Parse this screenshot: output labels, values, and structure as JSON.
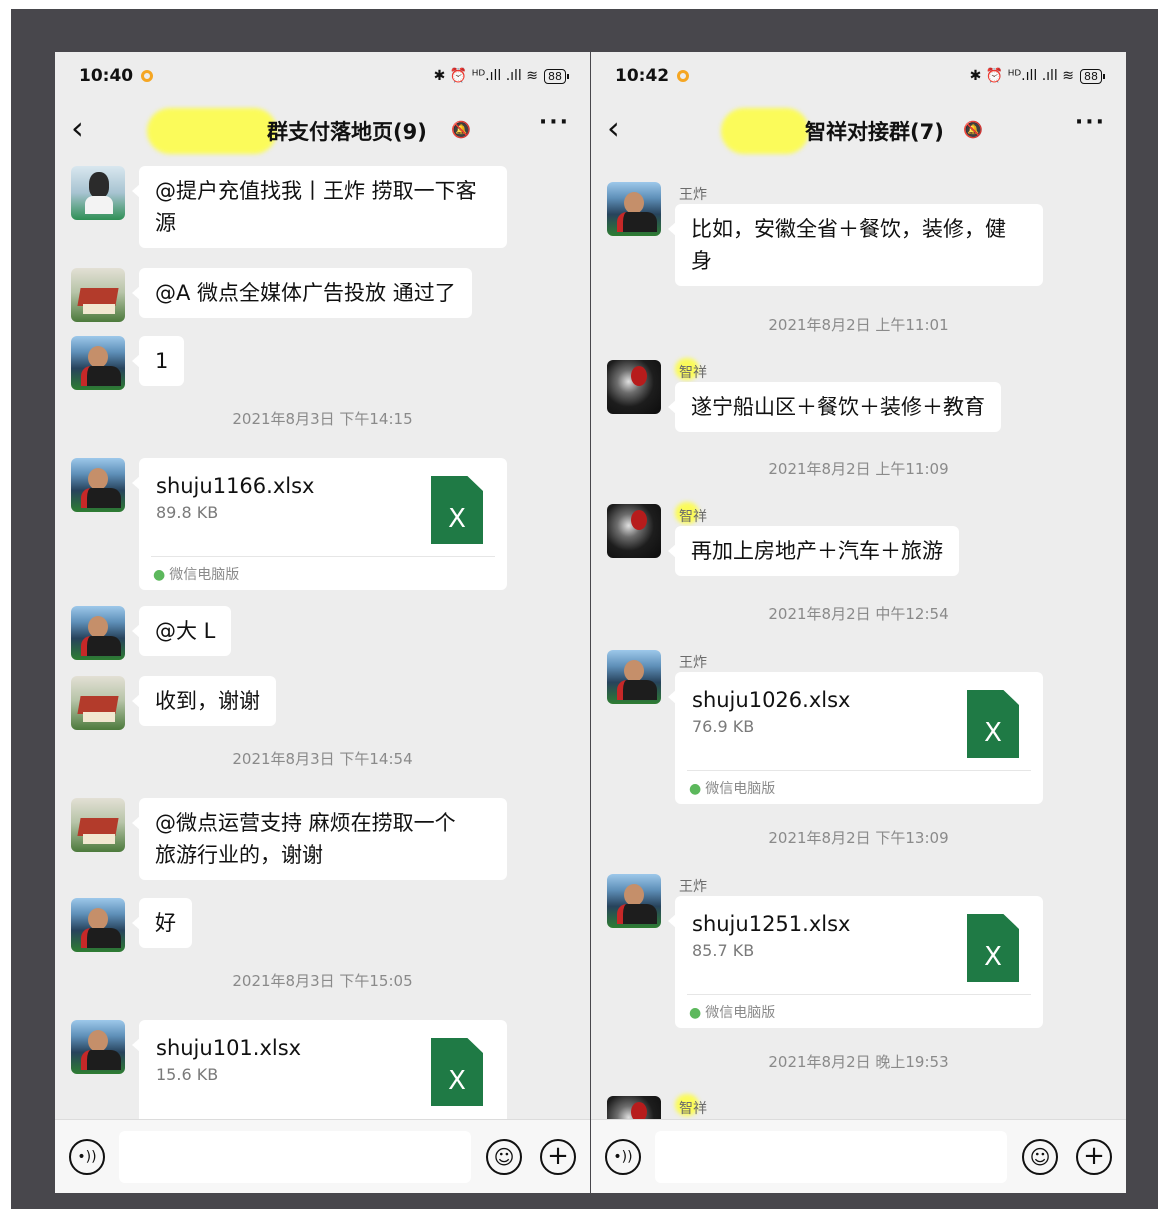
{
  "left": {
    "status": {
      "time": "10:40",
      "icons": "✱ ⏰ ᴴᴰ.ıll .ıll ≋",
      "battery": "88"
    },
    "title": "群支付落地页(9)",
    "messages": [
      {
        "type": "text",
        "avatar": "girl",
        "text": "@提户充值找我丨王炸 捞取一下客源",
        "lines": [
          "@提户充值找我丨王炸 捞取一下客",
          "源"
        ]
      },
      {
        "type": "text",
        "avatar": "house",
        "text": "@A 微点全媒体广告投放  通过了"
      },
      {
        "type": "text",
        "avatar": "man",
        "text": "1"
      },
      {
        "type": "time",
        "text": "2021年8月3日 下午14:15"
      },
      {
        "type": "file",
        "avatar": "man",
        "name": "shuju1166.xlsx",
        "size": "89.8 KB",
        "source": "微信电脑版"
      },
      {
        "type": "text",
        "avatar": "man",
        "text": "@大 L"
      },
      {
        "type": "text",
        "avatar": "house",
        "text": "收到，谢谢"
      },
      {
        "type": "time",
        "text": "2021年8月3日 下午14:54"
      },
      {
        "type": "text",
        "avatar": "house",
        "text": "@微点运营支持  麻烦在捞取一个旅游行业的，谢谢",
        "lines": [
          "@微点运营支持  麻烦在捞取一个",
          "旅游行业的，谢谢"
        ]
      },
      {
        "type": "text",
        "avatar": "man",
        "text": "好"
      },
      {
        "type": "time",
        "text": "2021年8月3日 下午15:05"
      },
      {
        "type": "file",
        "avatar": "man",
        "name": "shuju101.xlsx",
        "size": "15.6 KB",
        "source": ""
      }
    ]
  },
  "right": {
    "status": {
      "time": "10:42",
      "icons": "✱ ⏰ ᴴᴰ.ıll .ıll ≋",
      "battery": "88"
    },
    "title": "智祥对接群(7)",
    "messages": [
      {
        "type": "text",
        "avatar": "man",
        "sender": "王炸",
        "text": "比如，安徽全省＋餐饮，装修，健身",
        "lines": [
          "比如，安徽全省＋餐饮，装修，健",
          "身"
        ]
      },
      {
        "type": "time",
        "text": "2021年8月2日 上午11:01"
      },
      {
        "type": "text",
        "avatar": "dark",
        "sender": "智祥",
        "text": "遂宁船山区＋餐饮＋装修＋教育"
      },
      {
        "type": "time",
        "text": "2021年8月2日 上午11:09"
      },
      {
        "type": "text",
        "avatar": "dark",
        "sender": "智祥",
        "text": "再加上房地产＋汽车＋旅游"
      },
      {
        "type": "time",
        "text": "2021年8月2日 中午12:54"
      },
      {
        "type": "file",
        "avatar": "man",
        "sender": "王炸",
        "name": "shuju1026.xlsx",
        "size": "76.9 KB",
        "source": "微信电脑版"
      },
      {
        "type": "time",
        "text": "2021年8月2日 下午13:09"
      },
      {
        "type": "file",
        "avatar": "man",
        "sender": "王炸",
        "name": "shuju1251.xlsx",
        "size": "85.7 KB",
        "source": "微信电脑版"
      },
      {
        "type": "time",
        "text": "2021年8月2日 晚上19:53"
      },
      {
        "type": "partial",
        "avatar": "dark",
        "sender": "智祥"
      }
    ]
  },
  "icons": {
    "back": "‹",
    "mute": "bell-off",
    "more": "···",
    "voice": "•))",
    "emoji": "☺",
    "plus": "+"
  },
  "colors": {
    "chat_bg": "#ededed",
    "file_icon": "#1f7a45",
    "highlight": "#fbfb5a"
  }
}
